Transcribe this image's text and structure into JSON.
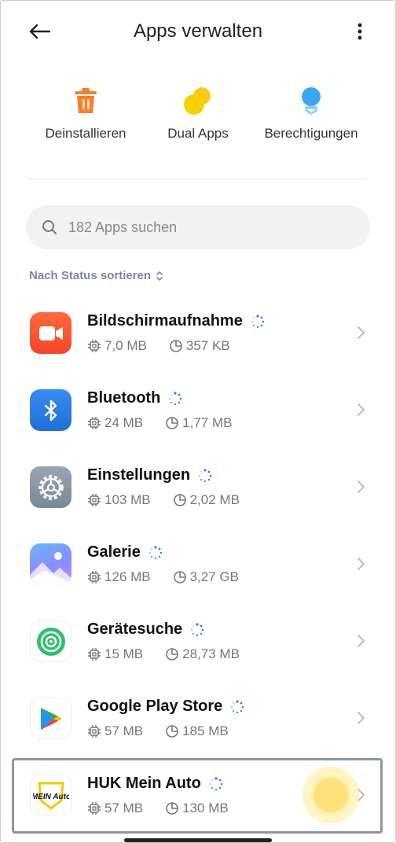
{
  "header": {
    "title": "Apps verwalten"
  },
  "quick_actions": [
    {
      "label": "Deinstallieren",
      "icon": "trash-icon"
    },
    {
      "label": "Dual Apps",
      "icon": "dual-apps-icon"
    },
    {
      "label": "Berechtigungen",
      "icon": "permissions-icon"
    }
  ],
  "search": {
    "placeholder": "182 Apps suchen"
  },
  "sort": {
    "label": "Nach Status sortieren"
  },
  "apps": [
    {
      "name": "Bildschirmaufnahme",
      "app_size": "7,0 MB",
      "data_size": "357 KB",
      "icon": "screen-recorder-icon"
    },
    {
      "name": "Bluetooth",
      "app_size": "24 MB",
      "data_size": "1,77 MB",
      "icon": "bluetooth-icon"
    },
    {
      "name": "Einstellungen",
      "app_size": "103 MB",
      "data_size": "2,02 MB",
      "icon": "settings-gear-icon"
    },
    {
      "name": "Galerie",
      "app_size": "126 MB",
      "data_size": "3,27 GB",
      "icon": "gallery-icon"
    },
    {
      "name": "Gerätesuche",
      "app_size": "15 MB",
      "data_size": "28,73 MB",
      "icon": "find-device-icon"
    },
    {
      "name": "Google Play Store",
      "app_size": "57 MB",
      "data_size": "185 MB",
      "icon": "play-store-icon"
    },
    {
      "name": "HUK Mein Auto",
      "app_size": "57 MB",
      "data_size": "130 MB",
      "icon": "huk-mein-auto-icon",
      "icon_text": "MEIN Auto"
    }
  ],
  "colors": {
    "accent_sort": "#7a85a8",
    "spinner": "#2f7df6",
    "trash": "#f5812c",
    "dual": "#f7c400",
    "permissions": "#3aa8f0"
  }
}
